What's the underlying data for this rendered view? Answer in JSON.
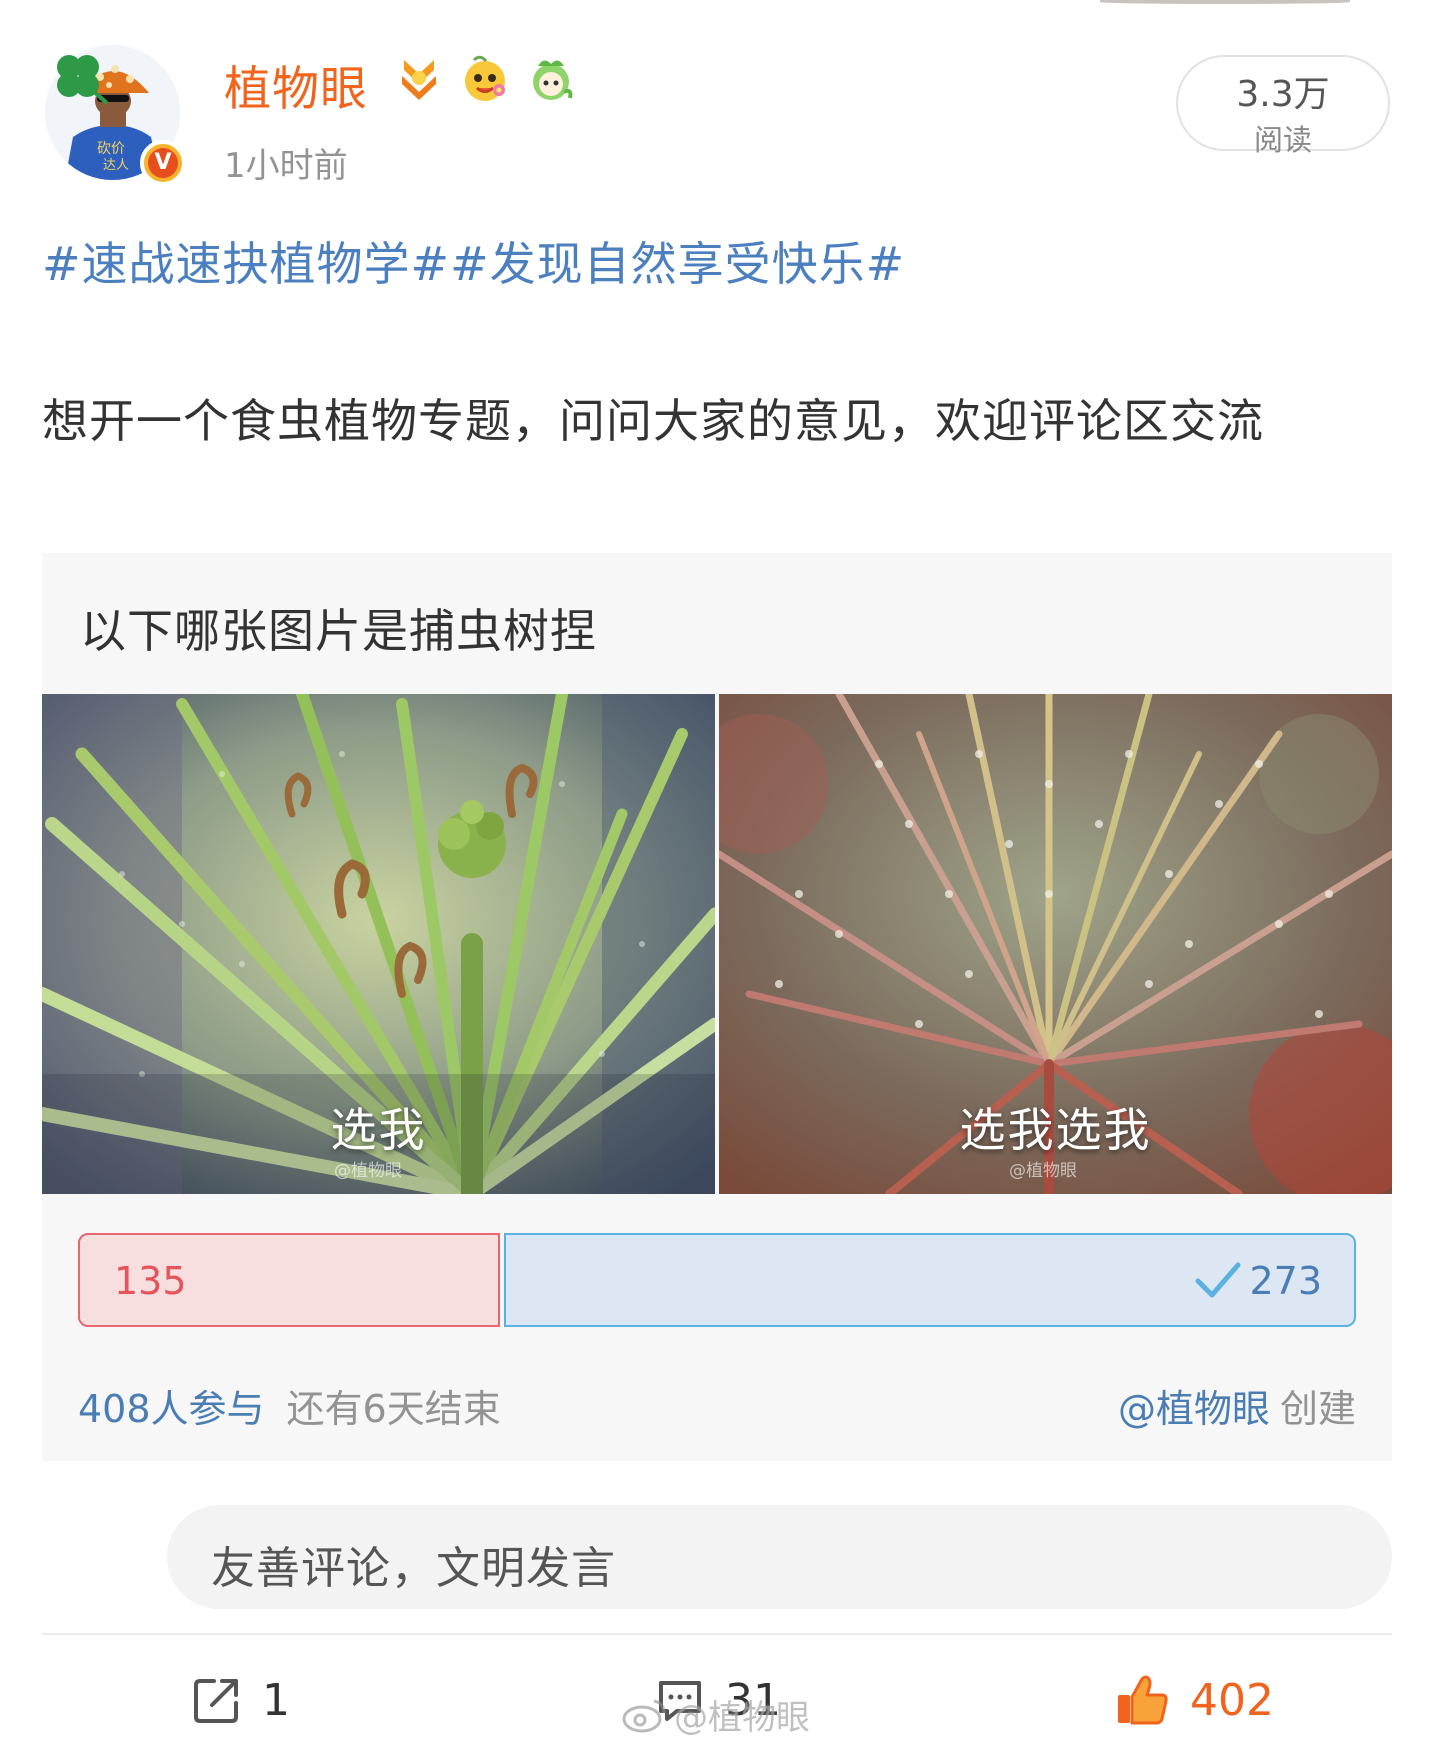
{
  "author": {
    "name": "植物眼",
    "post_time": "1小时前",
    "badges": [
      "medal-icon",
      "smiley-flower-icon",
      "green-mascot-icon"
    ],
    "verified_color": "#e64e1e"
  },
  "reads": {
    "count": "3.3万",
    "label": "阅读"
  },
  "post": {
    "hashtags": "#速战速抉植物学##发现自然享受快乐#",
    "text": "想开一个食虫植物专题，问问大家的意见，欢迎评论区交流"
  },
  "poll": {
    "question": "以下哪张图片是捕虫树捏",
    "options": [
      {
        "label": "选我",
        "watermark": "@植物眼",
        "votes": 135,
        "votes_text": "135",
        "color": "#e5666c"
      },
      {
        "label": "选我选我",
        "watermark": "@植物眼",
        "votes": 273,
        "votes_text": "273",
        "color": "#5bb2e0",
        "selected": true
      }
    ],
    "participants": "408人参与",
    "time_left": "还有6天结束",
    "creator_link": "@植物眼",
    "creator_suffix": "创建"
  },
  "comment_input": {
    "placeholder": "友善评论，文明发言"
  },
  "actions": {
    "repost_count": "1",
    "comment_count": "31",
    "like_count": "402",
    "like_color": "#f0641e"
  },
  "watermark": "@植物眼",
  "colors": {
    "link_blue": "#4c7fbf",
    "username_orange": "#f0641e"
  }
}
